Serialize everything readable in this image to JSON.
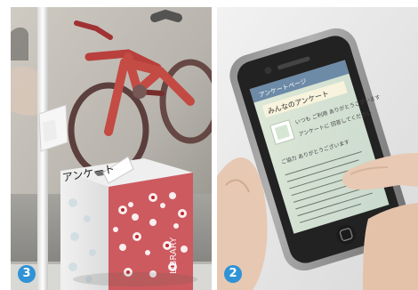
{
  "images": [
    {
      "badge": "3",
      "badge_color": "#2f93d6"
    },
    {
      "badge": "2",
      "badge_color": "#2f93d6"
    }
  ],
  "box": {
    "card_text": "アンケート",
    "side_text": "LIBRARY"
  },
  "phone": {
    "header_text": "アンケートページ",
    "title_text": "みんなのアンケート",
    "body_lines": [
      "いつも ご利用 ありがとうございます",
      "アンケートに 回答してください",
      "ご協力 ありがとうございます"
    ]
  }
}
